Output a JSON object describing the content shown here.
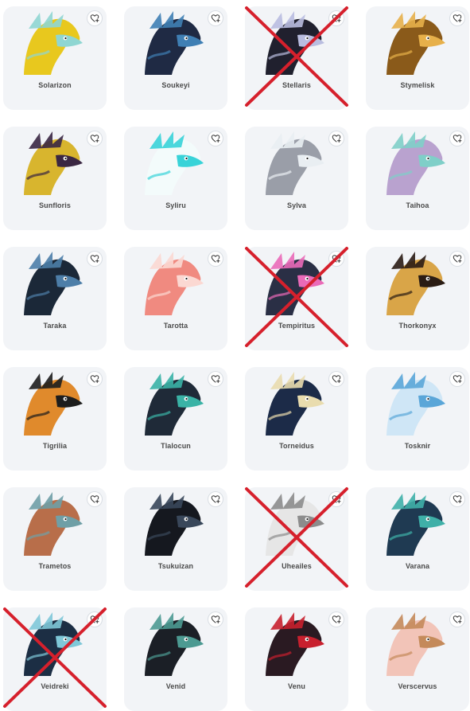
{
  "cards": [
    {
      "name": "Solarizon",
      "colors": [
        "#e8c81e",
        "#8fd6d2"
      ],
      "struck": false
    },
    {
      "name": "Soukeyi",
      "colors": [
        "#1f2a44",
        "#3f7fb4"
      ],
      "struck": false
    },
    {
      "name": "Stellaris",
      "colors": [
        "#20202e",
        "#b9bde0"
      ],
      "struck": true
    },
    {
      "name": "Stymelisk",
      "colors": [
        "#8a5a1a",
        "#e7b04a"
      ],
      "struck": false
    },
    {
      "name": "Sunfloris",
      "colors": [
        "#d8b52e",
        "#3a2742"
      ],
      "struck": false
    },
    {
      "name": "Syliru",
      "colors": [
        "#f3fbfb",
        "#38d3d8"
      ],
      "struck": false
    },
    {
      "name": "Sylva",
      "colors": [
        "#9a9ea8",
        "#e9eef2"
      ],
      "struck": false
    },
    {
      "name": "Taihoa",
      "colors": [
        "#b9a2cf",
        "#7fcfc8"
      ],
      "struck": false
    },
    {
      "name": "Taraka",
      "colors": [
        "#1b2838",
        "#4d7ea8"
      ],
      "struck": false
    },
    {
      "name": "Tarotta",
      "colors": [
        "#f08a80",
        "#fbd8d2"
      ],
      "struck": false
    },
    {
      "name": "Tempiritus",
      "colors": [
        "#2a2f45",
        "#ea6ab8"
      ],
      "struck": true
    },
    {
      "name": "Thorkonyx",
      "colors": [
        "#d9a548",
        "#2a1c14"
      ],
      "struck": false
    },
    {
      "name": "Tigrilia",
      "colors": [
        "#e08a2c",
        "#1d1d1d"
      ],
      "struck": false
    },
    {
      "name": "Tlalocun",
      "colors": [
        "#1f2a38",
        "#3ab3a6"
      ],
      "struck": false
    },
    {
      "name": "Torneidus",
      "colors": [
        "#1c2b48",
        "#e9dcae"
      ],
      "struck": false
    },
    {
      "name": "Tosknir",
      "colors": [
        "#cfe6f6",
        "#5aa6d8"
      ],
      "struck": false
    },
    {
      "name": "Trametos",
      "colors": [
        "#b86e4a",
        "#6f9fa6"
      ],
      "struck": false
    },
    {
      "name": "Tsukuizan",
      "colors": [
        "#15181f",
        "#39475a"
      ],
      "struck": false
    },
    {
      "name": "Uheailes",
      "colors": [
        "#e6e6e6",
        "#8c8c8c"
      ],
      "struck": true
    },
    {
      "name": "Varana",
      "colors": [
        "#1f3a52",
        "#3fb0a8"
      ],
      "struck": false
    },
    {
      "name": "Veidreki",
      "colors": [
        "#1c2e44",
        "#7fc8d8"
      ],
      "struck": true
    },
    {
      "name": "Venid",
      "colors": [
        "#1b1f26",
        "#4c9a92"
      ],
      "struck": false
    },
    {
      "name": "Venu",
      "colors": [
        "#2a1a22",
        "#c8202e"
      ],
      "struck": false
    },
    {
      "name": "Verscervus",
      "colors": [
        "#f2c4b8",
        "#c48a5a"
      ],
      "struck": false
    }
  ],
  "theme": {
    "card_bg": "#f2f4f7",
    "name_color": "#4a4a4a",
    "cross_color": "#d6202c",
    "fav_icon": "heart-plus-icon"
  }
}
